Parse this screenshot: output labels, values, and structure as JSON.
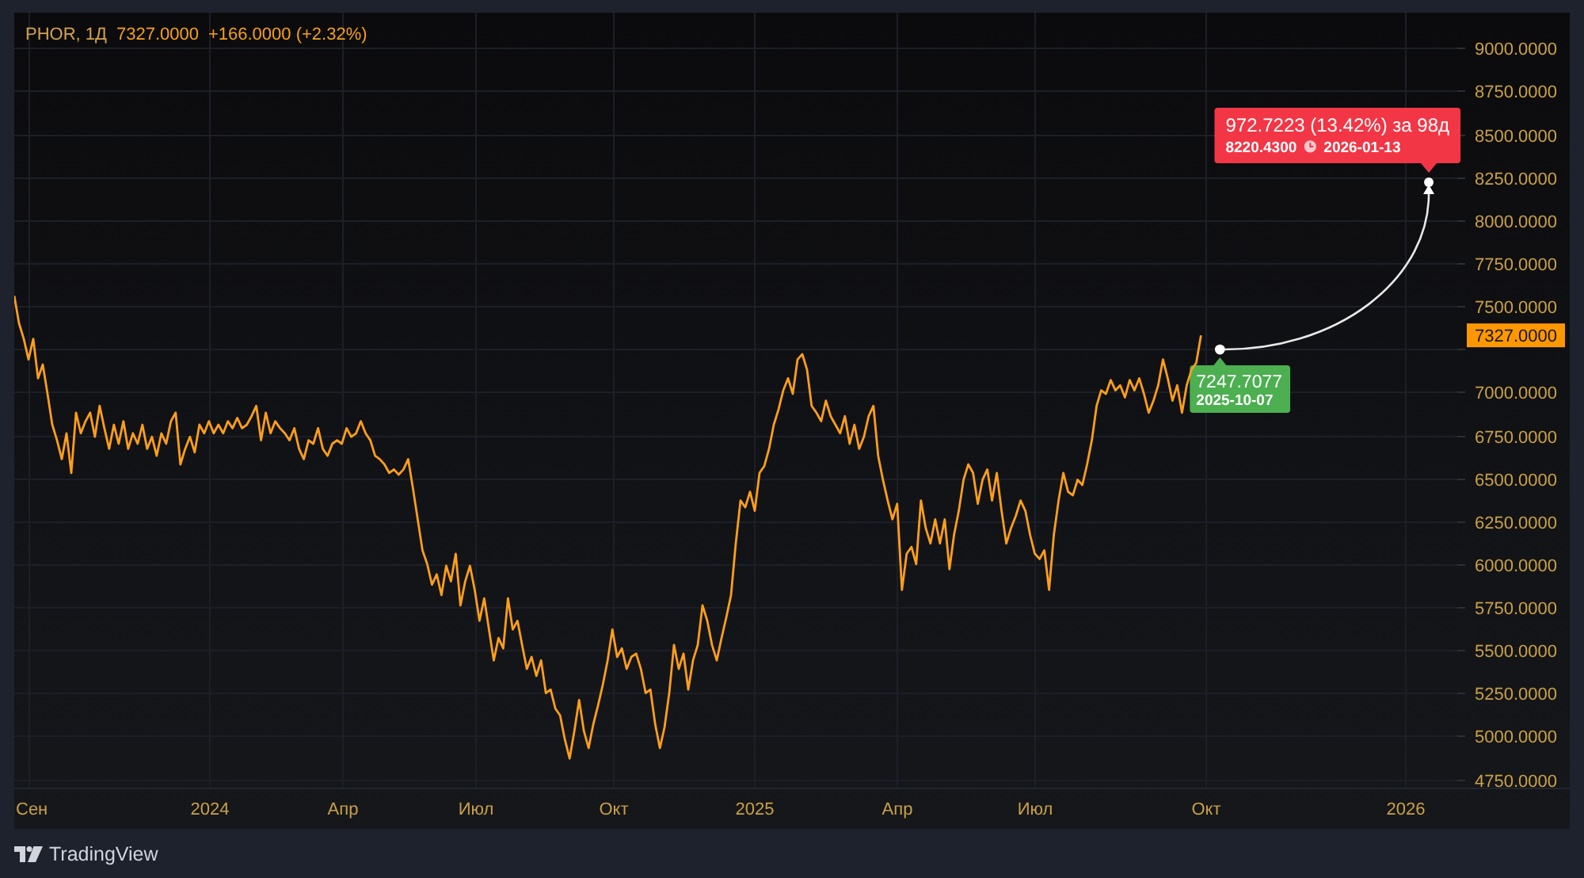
{
  "legend": {
    "symbol": "PHOR, 1Д",
    "price": "7327.0000",
    "change": "+166.0000 (+2.32%)"
  },
  "chart": {
    "last_price_label": "7327.0000",
    "chart_data": {
      "type": "line",
      "grid": true,
      "categories": [
        null,
        null,
        null,
        "Сен",
        null,
        null,
        null,
        null,
        null,
        null,
        null,
        null,
        null,
        null,
        null,
        null,
        null,
        null,
        null,
        null,
        null,
        null,
        null,
        null,
        null,
        null,
        null,
        null,
        null,
        null,
        null,
        null,
        null,
        null,
        null,
        null,
        null,
        null,
        null,
        null,
        null,
        "2024",
        null,
        null,
        null,
        null,
        null,
        null,
        null,
        null,
        null,
        null,
        null,
        null,
        null,
        null,
        null,
        null,
        null,
        null,
        null,
        null,
        null,
        null,
        null,
        null,
        null,
        null,
        null,
        "Апр",
        null,
        null,
        null,
        null,
        null,
        null,
        null,
        null,
        null,
        null,
        null,
        null,
        null,
        null,
        null,
        null,
        null,
        null,
        null,
        null,
        null,
        null,
        null,
        null,
        null,
        null,
        null,
        "Июл",
        null,
        null,
        null,
        null,
        null,
        null,
        null,
        null,
        null,
        null,
        null,
        null,
        null,
        null,
        null,
        null,
        null,
        null,
        null,
        null,
        null,
        null,
        null,
        null,
        null,
        null,
        null,
        null,
        "Окт",
        null,
        null,
        null,
        null,
        null,
        null,
        null,
        null,
        null,
        null,
        null,
        null,
        null,
        null,
        null,
        null,
        null,
        null,
        null,
        null,
        null,
        null,
        null,
        null,
        null,
        null,
        null,
        null,
        null,
        "2025",
        null,
        null,
        null,
        null,
        null,
        null,
        null,
        null,
        null,
        null,
        null,
        null,
        null,
        null,
        null,
        null,
        null,
        null,
        null,
        null,
        null,
        null,
        null,
        null,
        null,
        null,
        null,
        null,
        null,
        "Апр",
        null,
        null,
        null,
        null,
        null,
        null,
        null,
        null,
        null,
        null,
        null,
        null,
        null,
        null,
        null,
        null,
        null,
        null,
        null,
        null,
        null,
        null,
        null,
        null,
        null,
        null,
        null,
        null,
        "Июл",
        null,
        null,
        null,
        null,
        null,
        null,
        null,
        null,
        null,
        null,
        null,
        null,
        null,
        null,
        null,
        null,
        null,
        null,
        null,
        null,
        null,
        null,
        null,
        null,
        null,
        null,
        null,
        null,
        null,
        null,
        null,
        null,
        null,
        null,
        null,
        "Окт",
        null,
        null,
        null,
        null,
        null,
        null,
        null,
        null,
        null,
        null,
        null,
        null,
        null,
        null,
        null,
        null,
        null,
        null,
        null,
        null,
        null,
        null,
        null,
        null,
        null,
        null,
        null,
        null,
        null,
        null,
        null,
        null,
        null,
        null,
        null,
        null,
        null,
        null,
        null,
        null,
        null,
        "2026",
        null,
        null,
        null,
        null,
        null,
        null,
        null,
        null,
        null,
        null
      ],
      "series": [
        {
          "color": "#ff9f1a",
          "values": [
            7560,
            7400,
            7310,
            7190,
            7310,
            7080,
            7160,
            6990,
            6810,
            6720,
            6610,
            6760,
            6530,
            6880,
            6760,
            6830,
            6880,
            6740,
            6920,
            6790,
            6670,
            6810,
            6700,
            6830,
            6670,
            6760,
            6700,
            6810,
            6670,
            6740,
            6630,
            6760,
            6700,
            6830,
            6880,
            6580,
            6670,
            6740,
            6650,
            6810,
            6760,
            6830,
            6760,
            6810,
            6760,
            6830,
            6790,
            6850,
            6790,
            6810,
            6860,
            6920,
            6720,
            6880,
            6760,
            6830,
            6790,
            6760,
            6720,
            6790,
            6670,
            6610,
            6720,
            6700,
            6790,
            6670,
            6630,
            6700,
            6720,
            6700,
            6790,
            6740,
            6760,
            6830,
            6760,
            6720,
            6630,
            6610,
            6580,
            6530,
            6550,
            6520,
            6550,
            6610,
            6440,
            6260,
            6080,
            6000,
            5880,
            5940,
            5820,
            5990,
            5900,
            6060,
            5760,
            5900,
            5990,
            5850,
            5670,
            5800,
            5620,
            5440,
            5570,
            5510,
            5800,
            5620,
            5670,
            5530,
            5390,
            5460,
            5350,
            5440,
            5250,
            5270,
            5160,
            5120,
            4980,
            4870,
            5030,
            5210,
            5030,
            4930,
            5070,
            5180,
            5300,
            5440,
            5620,
            5460,
            5510,
            5390,
            5460,
            5480,
            5390,
            5250,
            5270,
            5070,
            4930,
            5050,
            5250,
            5530,
            5390,
            5480,
            5270,
            5440,
            5530,
            5760,
            5670,
            5530,
            5440,
            5570,
            5690,
            5820,
            6120,
            6370,
            6330,
            6420,
            6310,
            6530,
            6570,
            6670,
            6810,
            6900,
            7010,
            7080,
            6990,
            7190,
            7220,
            7130,
            6920,
            6880,
            6830,
            6950,
            6860,
            6810,
            6760,
            6860,
            6700,
            6810,
            6670,
            6740,
            6860,
            6920,
            6630,
            6490,
            6370,
            6260,
            6350,
            5850,
            6060,
            6100,
            6000,
            6370,
            6210,
            6120,
            6260,
            6120,
            6260,
            5970,
            6170,
            6310,
            6490,
            6580,
            6530,
            6350,
            6490,
            6550,
            6370,
            6530,
            6310,
            6120,
            6210,
            6280,
            6370,
            6310,
            6170,
            6060,
            6030,
            6080,
            5850,
            6170,
            6370,
            6530,
            6420,
            6400,
            6490,
            6460,
            6580,
            6720,
            6920,
            7010,
            6990,
            7070,
            7010,
            7040,
            6970,
            7070,
            7010,
            7080,
            6990,
            6880,
            6950,
            7040,
            7190,
            7080,
            6950,
            7040,
            6880,
            7040,
            7130,
            7170,
            7330,
            null,
            null,
            null,
            null,
            null,
            null,
            null,
            null,
            null,
            null,
            null,
            null,
            null,
            null,
            null,
            null,
            null,
            null,
            null,
            null,
            null,
            null,
            null,
            null,
            null,
            null,
            null,
            null,
            null,
            null,
            null,
            null,
            null,
            null,
            null,
            null,
            null,
            null,
            null,
            null,
            null,
            null,
            null,
            null,
            null,
            null,
            null,
            null,
            null,
            null,
            null,
            null,
            null
          ]
        }
      ],
      "ylim": [
        4700,
        9206
      ],
      "yticks": [
        {
          "value": 4750,
          "label": "4750.0000"
        },
        {
          "value": 5000,
          "label": "5000.0000"
        },
        {
          "value": 5250,
          "label": "5250.0000"
        },
        {
          "value": 5500,
          "label": "5500.0000"
        },
        {
          "value": 5750,
          "label": "5750.0000"
        },
        {
          "value": 6000,
          "label": "6000.0000"
        },
        {
          "value": 6250,
          "label": "6250.0000"
        },
        {
          "value": 6500,
          "label": "6500.0000"
        },
        {
          "value": 6750,
          "label": "6750.0000"
        },
        {
          "value": 7000,
          "label": "7000.0000"
        },
        {
          "value": 7500,
          "label": "7500.0000"
        },
        {
          "value": 7750,
          "label": "7750.0000"
        },
        {
          "value": 8000,
          "label": "8000.0000"
        },
        {
          "value": 8250,
          "label": "8250.0000"
        },
        {
          "value": 8500,
          "label": "8500.0000"
        },
        {
          "value": 8750,
          "label": "8750.0000"
        },
        {
          "value": 9000,
          "label": "9000.0000"
        }
      ]
    },
    "forecast": {
      "start_price": "7247.7077",
      "start_date": "2025-10-07",
      "change": "972.7223 (13.42%) за 98д",
      "target_price": "8220.4300",
      "target_date": "2026-01-13"
    }
  },
  "footer": {
    "brand": "TradingView"
  }
}
